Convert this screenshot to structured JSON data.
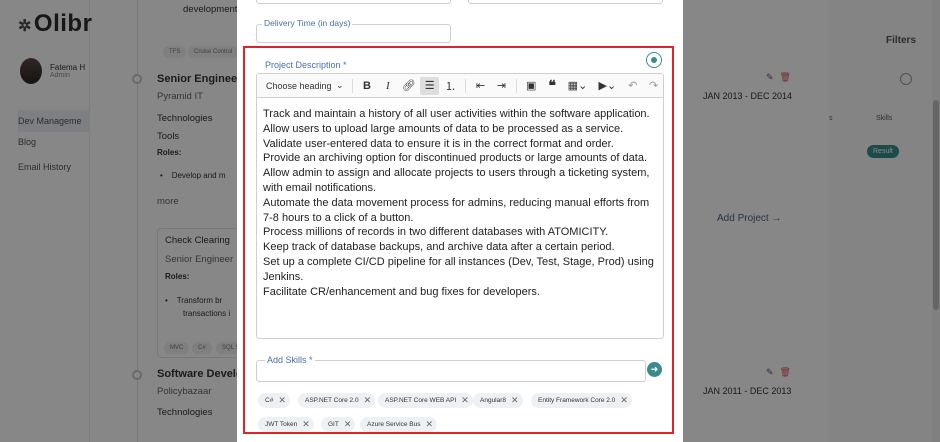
{
  "background": {
    "logo_text": "Olibr",
    "user": {
      "name": "Fatema H",
      "role": "Admin"
    },
    "sidebar_links": [
      "Dev Manageme",
      "Blog",
      "Email History"
    ],
    "top_text": "development",
    "chips_top": [
      "TFS",
      "Cruise Control"
    ],
    "job1": {
      "title": "Senior Engineer",
      "company": "Pyramid IT",
      "technologies": "Technologies",
      "tools": "Tools",
      "roles": "Roles:",
      "bullet": "Develop and m",
      "more": "more",
      "date": "JAN 2013 - DEC 2014"
    },
    "card": {
      "title": "Check Clearing",
      "role": "Senior Engineer",
      "roles": "Roles:",
      "bullet1": "Transform br",
      "bullet2": "transactions i",
      "chips": [
        "MVC",
        "C#",
        "SQL S"
      ]
    },
    "add_project": "Add Project →",
    "job2": {
      "title": "Software Develo",
      "company": "Policybazaar",
      "technologies": "Technologies",
      "date": "JAN 2011 - DEC 2013"
    },
    "right": {
      "filters": "Filters",
      "skills": "Skills",
      "s_header": "s",
      "result": "Result"
    }
  },
  "modal": {
    "delivery_label": "Delivery Time (in days)",
    "project_description_label": "Project Description *",
    "heading_select": "Choose heading",
    "description_lines": [
      "Track and maintain a history of all user activities within the software application.",
      "Allow users to upload large amounts of data to be processed as a service.",
      "Validate user-entered data to ensure it is in the correct format and order.",
      "Provide an archiving option for discontinued products or large amounts of data.",
      "Allow admin to assign and allocate projects to users through a ticketing system, with email notifications.",
      "Automate the data movement process for admins, reducing manual efforts from 7-8 hours to a click of a button.",
      "Process millions of records in two different databases with ATOMICITY.",
      "Keep track of database backups, and archive data after a certain period.",
      "Set up a complete CI/CD pipeline for all instances (Dev, Test, Stage, Prod) using Jenkins.",
      "Facilitate CR/enhancement and bug fixes for developers."
    ],
    "skills_label": "Add Skills *",
    "skills": [
      "C#",
      "ASP.NET Core 2.0",
      "ASP.NET Core WEB API",
      "Angular8",
      "Entity Framework Core 2.0",
      "JWT Token",
      "GIT",
      "Azure Service Bus"
    ]
  },
  "colors": {
    "accent": "#3a8c8c",
    "highlight_frame": "#e0222d",
    "label": "#4b6fa6",
    "delete": "#d9534f"
  },
  "icons": [
    "bold-icon",
    "italic-icon",
    "link-icon",
    "bulleted-list-icon",
    "numbered-list-icon",
    "outdent-icon",
    "indent-icon",
    "image-icon",
    "quote-icon",
    "table-icon",
    "media-icon",
    "undo-icon",
    "redo-icon",
    "ai-assist-icon",
    "add-icon",
    "close-icon",
    "edit-icon",
    "delete-icon",
    "search-icon"
  ]
}
